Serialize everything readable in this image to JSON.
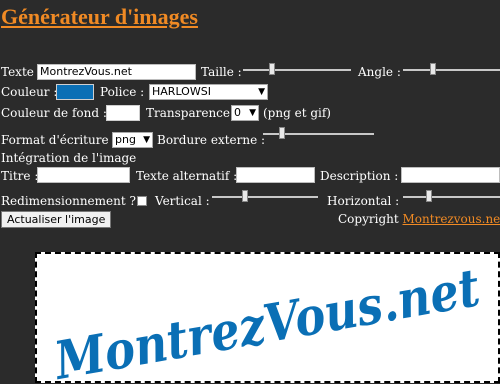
{
  "header": {
    "title": "Générateur d'images"
  },
  "form": {
    "text_label": "Texte :",
    "text_value": "MontrezVous.net",
    "size_label": "Taille :",
    "size_level": 0.25,
    "angle_label": "Angle :",
    "angle_level": 0.3,
    "color_label": "Couleur :",
    "color_value": "#0a6fb5",
    "font_label": "Police :",
    "font_value": "HARLOWSI",
    "bg_label": "Couleur de fond :",
    "bg_value": "#ffffff",
    "transparency_label": "Transparence :",
    "transparency_value": "0",
    "transparency_note": "(png et gif)",
    "format_label": "Format d'écriture :",
    "format_value": "png",
    "border_label": "Bordure externe :",
    "border_level": 0.15,
    "integration_label": "Intégration de l'image",
    "title_label": "Titre :",
    "title_value": "",
    "alt_label": "Texte alternatif :",
    "alt_value": "",
    "desc_label": "Description :",
    "desc_value": "",
    "resize_label": "Redimensionnement ?",
    "resize_checked": false,
    "vertical_label": "Vertical :",
    "vertical_level": 0.3,
    "horizontal_label": "Horizontal :",
    "horizontal_level": 0.25,
    "update_button": "Actualiser l'image",
    "copyright_label": "Copyright",
    "copyright_link": "Montrezvous.net"
  },
  "preview": {
    "text": "MontrezVous.net",
    "text_color": "#0a6fb5"
  }
}
